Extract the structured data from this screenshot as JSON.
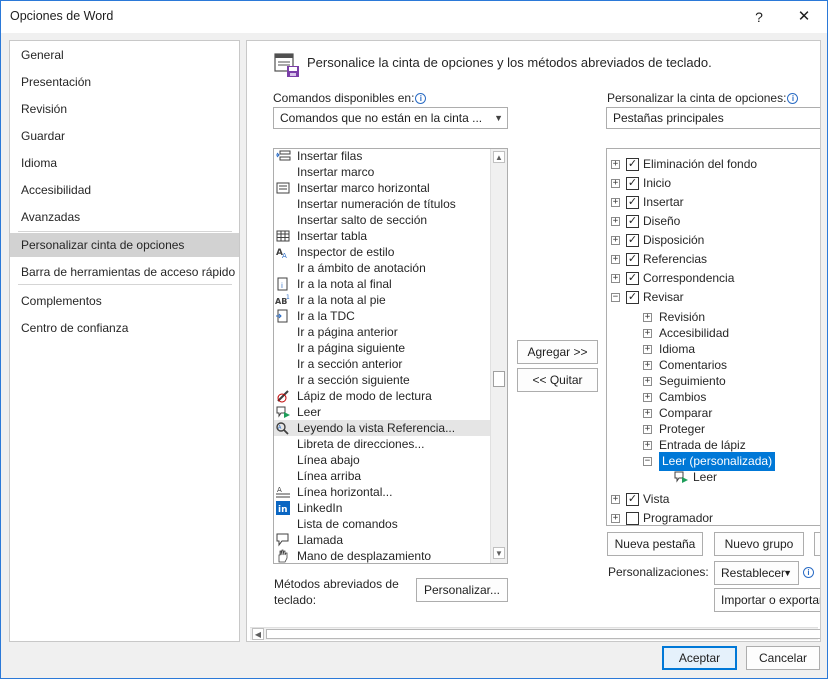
{
  "window": {
    "title": "Opciones de Word",
    "help": "?",
    "close": "✕"
  },
  "nav": {
    "items": [
      {
        "label": "General"
      },
      {
        "label": "Presentación"
      },
      {
        "label": "Revisión"
      },
      {
        "label": "Guardar"
      },
      {
        "label": "Idioma"
      },
      {
        "label": "Accesibilidad"
      },
      {
        "label": "Avanzadas"
      },
      {
        "label": "Personalizar cinta de opciones"
      },
      {
        "label": "Barra de herramientas de acceso rápido"
      },
      {
        "label": "Complementos"
      },
      {
        "label": "Centro de confianza"
      }
    ],
    "selected": "Personalizar cinta de opciones"
  },
  "header": {
    "text": "Personalice la cinta de opciones y los métodos abreviados de teclado."
  },
  "left": {
    "label": "Comandos disponibles en:",
    "combo_value": "Comandos que no están en la cinta ...",
    "items": [
      {
        "label": "Insertar filas",
        "icon": "insert-rows-icon"
      },
      {
        "label": "Insertar marco",
        "icon": ""
      },
      {
        "label": "Insertar marco horizontal",
        "icon": "horizontal-frame-icon"
      },
      {
        "label": "Insertar numeración de títulos",
        "icon": ""
      },
      {
        "label": "Insertar salto de sección",
        "icon": ""
      },
      {
        "label": "Insertar tabla",
        "icon": "table-icon"
      },
      {
        "label": "Inspector de estilo",
        "icon": "style-inspector-icon"
      },
      {
        "label": "Ir a ámbito de anotación",
        "icon": ""
      },
      {
        "label": "Ir a la nota al final",
        "icon": "endnote-icon"
      },
      {
        "label": "Ir a la nota al pie",
        "icon": "footnote-icon"
      },
      {
        "label": "Ir a la TDC",
        "icon": "toc-icon"
      },
      {
        "label": "Ir a página anterior",
        "icon": ""
      },
      {
        "label": "Ir a página siguiente",
        "icon": ""
      },
      {
        "label": "Ir a sección anterior",
        "icon": ""
      },
      {
        "label": "Ir a sección siguiente",
        "icon": ""
      },
      {
        "label": "Lápiz de modo de lectura",
        "icon": "reading-pencil-icon"
      },
      {
        "label": "Leer",
        "icon": "read-aloud-icon"
      },
      {
        "label": "Leyendo la vista Referencia...",
        "icon": "reference-view-icon"
      },
      {
        "label": "Libreta de direcciones...",
        "icon": ""
      },
      {
        "label": "Línea abajo",
        "icon": ""
      },
      {
        "label": "Línea arriba",
        "icon": ""
      },
      {
        "label": "Línea horizontal...",
        "icon": "horizontal-line-icon"
      },
      {
        "label": "LinkedIn",
        "icon": "linkedin-icon"
      },
      {
        "label": "Lista de comandos",
        "icon": ""
      },
      {
        "label": "Llamada",
        "icon": "callout-icon"
      },
      {
        "label": "Mano de desplazamiento",
        "icon": "hand-icon"
      }
    ],
    "selected": "Leyendo la vista Referencia...",
    "shortcuts_label_1": "Métodos abreviados de",
    "shortcuts_label_2": "teclado:",
    "customize_button": "Personalizar..."
  },
  "middle": {
    "add_button": "Agregar >>",
    "remove_button": "<< Quitar"
  },
  "right": {
    "label": "Personalizar la cinta de opciones:",
    "combo_value": "Pestañas principales",
    "tree": [
      {
        "label": "Eliminación del fondo",
        "level": 0,
        "exp": "+",
        "checked": true
      },
      {
        "label": "Inicio",
        "level": 0,
        "exp": "+",
        "checked": true
      },
      {
        "label": "Insertar",
        "level": 0,
        "exp": "+",
        "checked": true
      },
      {
        "label": "Diseño",
        "level": 0,
        "exp": "+",
        "checked": true
      },
      {
        "label": "Disposición",
        "level": 0,
        "exp": "+",
        "checked": true
      },
      {
        "label": "Referencias",
        "level": 0,
        "exp": "+",
        "checked": true
      },
      {
        "label": "Correspondencia",
        "level": 0,
        "exp": "+",
        "checked": true
      },
      {
        "label": "Revisar",
        "level": 0,
        "exp": "−",
        "checked": true
      },
      {
        "label": "Revisión",
        "level": 1,
        "exp": "+"
      },
      {
        "label": "Accesibilidad",
        "level": 1,
        "exp": "+"
      },
      {
        "label": "Idioma",
        "level": 1,
        "exp": "+"
      },
      {
        "label": "Comentarios",
        "level": 1,
        "exp": "+"
      },
      {
        "label": "Seguimiento",
        "level": 1,
        "exp": "+"
      },
      {
        "label": "Cambios",
        "level": 1,
        "exp": "+"
      },
      {
        "label": "Comparar",
        "level": 1,
        "exp": "+"
      },
      {
        "label": "Proteger",
        "level": 1,
        "exp": "+"
      },
      {
        "label": "Entrada de lápiz",
        "level": 1,
        "exp": "+"
      },
      {
        "label": "Leer (personalizada)",
        "level": 1,
        "exp": "−",
        "highlight": true
      },
      {
        "label": "Leer",
        "level": 2,
        "icon": "read-aloud-icon"
      },
      {
        "label": "Vista",
        "level": 0,
        "exp": "+",
        "checked": true
      },
      {
        "label": "Programador",
        "level": 0,
        "exp": "+",
        "checked": false
      }
    ],
    "new_tab_button": "Nueva pestaña",
    "new_group_button": "Nuevo grupo",
    "customizations_label": "Personalizaciones:",
    "reset_button": "Restablecer",
    "import_export_button": "Importar o exportar"
  },
  "footer": {
    "accept": "Aceptar",
    "cancel": "Cancelar"
  }
}
